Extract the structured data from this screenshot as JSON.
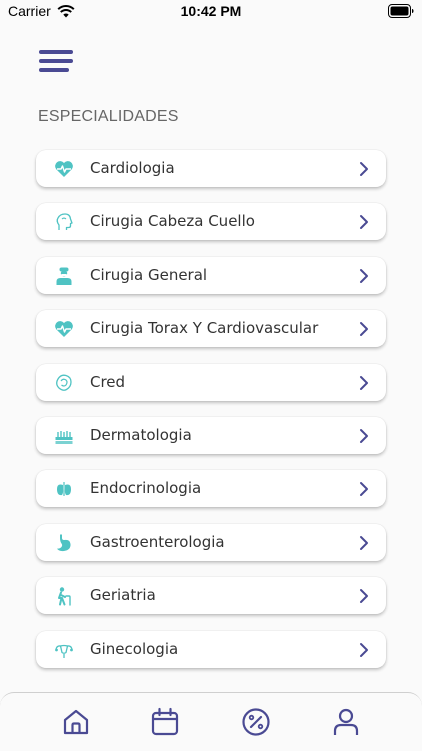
{
  "status_bar": {
    "carrier": "Carrier",
    "time": "10:42 PM"
  },
  "section_title": "ESPECIALIDADES",
  "colors": {
    "accent": "#4a4a93",
    "icon_teal": "#4fc3c3"
  },
  "specialties": [
    {
      "label": "Cardiologia",
      "icon": "heart-pulse-icon"
    },
    {
      "label": "Cirugia Cabeza Cuello",
      "icon": "head-icon"
    },
    {
      "label": "Cirugia General",
      "icon": "surgeon-icon"
    },
    {
      "label": "Cirugia Torax Y Cardiovascular",
      "icon": "heart-pulse-icon"
    },
    {
      "label": "Cred",
      "icon": "baby-icon"
    },
    {
      "label": "Dermatologia",
      "icon": "skin-layers-icon"
    },
    {
      "label": "Endocrinologia",
      "icon": "thyroid-icon"
    },
    {
      "label": "Gastroenterologia",
      "icon": "stomach-icon"
    },
    {
      "label": "Geriatria",
      "icon": "elderly-icon"
    },
    {
      "label": "Ginecologia",
      "icon": "uterus-icon"
    }
  ],
  "tabbar": [
    {
      "name": "home",
      "icon": "home-icon"
    },
    {
      "name": "calendar",
      "icon": "calendar-icon"
    },
    {
      "name": "discounts",
      "icon": "percent-icon"
    },
    {
      "name": "profile",
      "icon": "user-icon"
    }
  ]
}
